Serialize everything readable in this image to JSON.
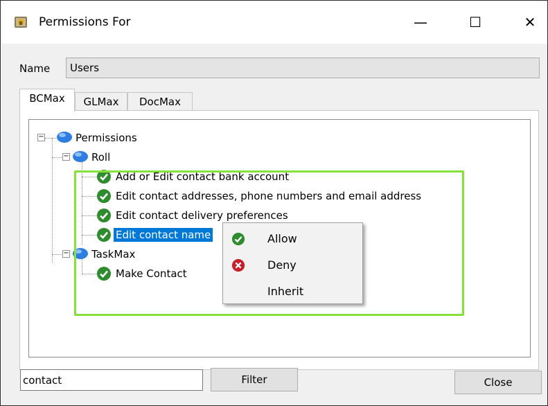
{
  "window": {
    "title": "Permissions For",
    "minimize_label": "—",
    "maximize_label": "☐",
    "close_label": "✕"
  },
  "name_field": {
    "label": "Name",
    "value": "Users"
  },
  "tabs": [
    {
      "label": "BCMax",
      "active": true
    },
    {
      "label": "GLMax",
      "active": false
    },
    {
      "label": "DocMax",
      "active": false
    }
  ],
  "tree": {
    "root": "Permissions",
    "groups": [
      {
        "label": "Roll",
        "items": [
          "Add or Edit contact bank account",
          "Edit contact addresses, phone numbers and email address",
          "Edit contact delivery preferences",
          "Edit contact name"
        ],
        "selected_item": "Edit contact name"
      },
      {
        "label": "TaskMax",
        "items": [
          "Make Contact"
        ]
      }
    ]
  },
  "context_menu": {
    "items": [
      {
        "label": "Allow",
        "icon": "allow-check-icon"
      },
      {
        "label": "Deny",
        "icon": "deny-x-icon"
      },
      {
        "label": "Inherit",
        "icon": ""
      }
    ]
  },
  "filter": {
    "value": "contact",
    "button_label": "Filter"
  },
  "close_button_label": "Close",
  "colors": {
    "highlight_border": "#86e03a",
    "selection": "#0078d7",
    "allow_green": "#2e8b2e",
    "deny_red": "#c8202a"
  }
}
